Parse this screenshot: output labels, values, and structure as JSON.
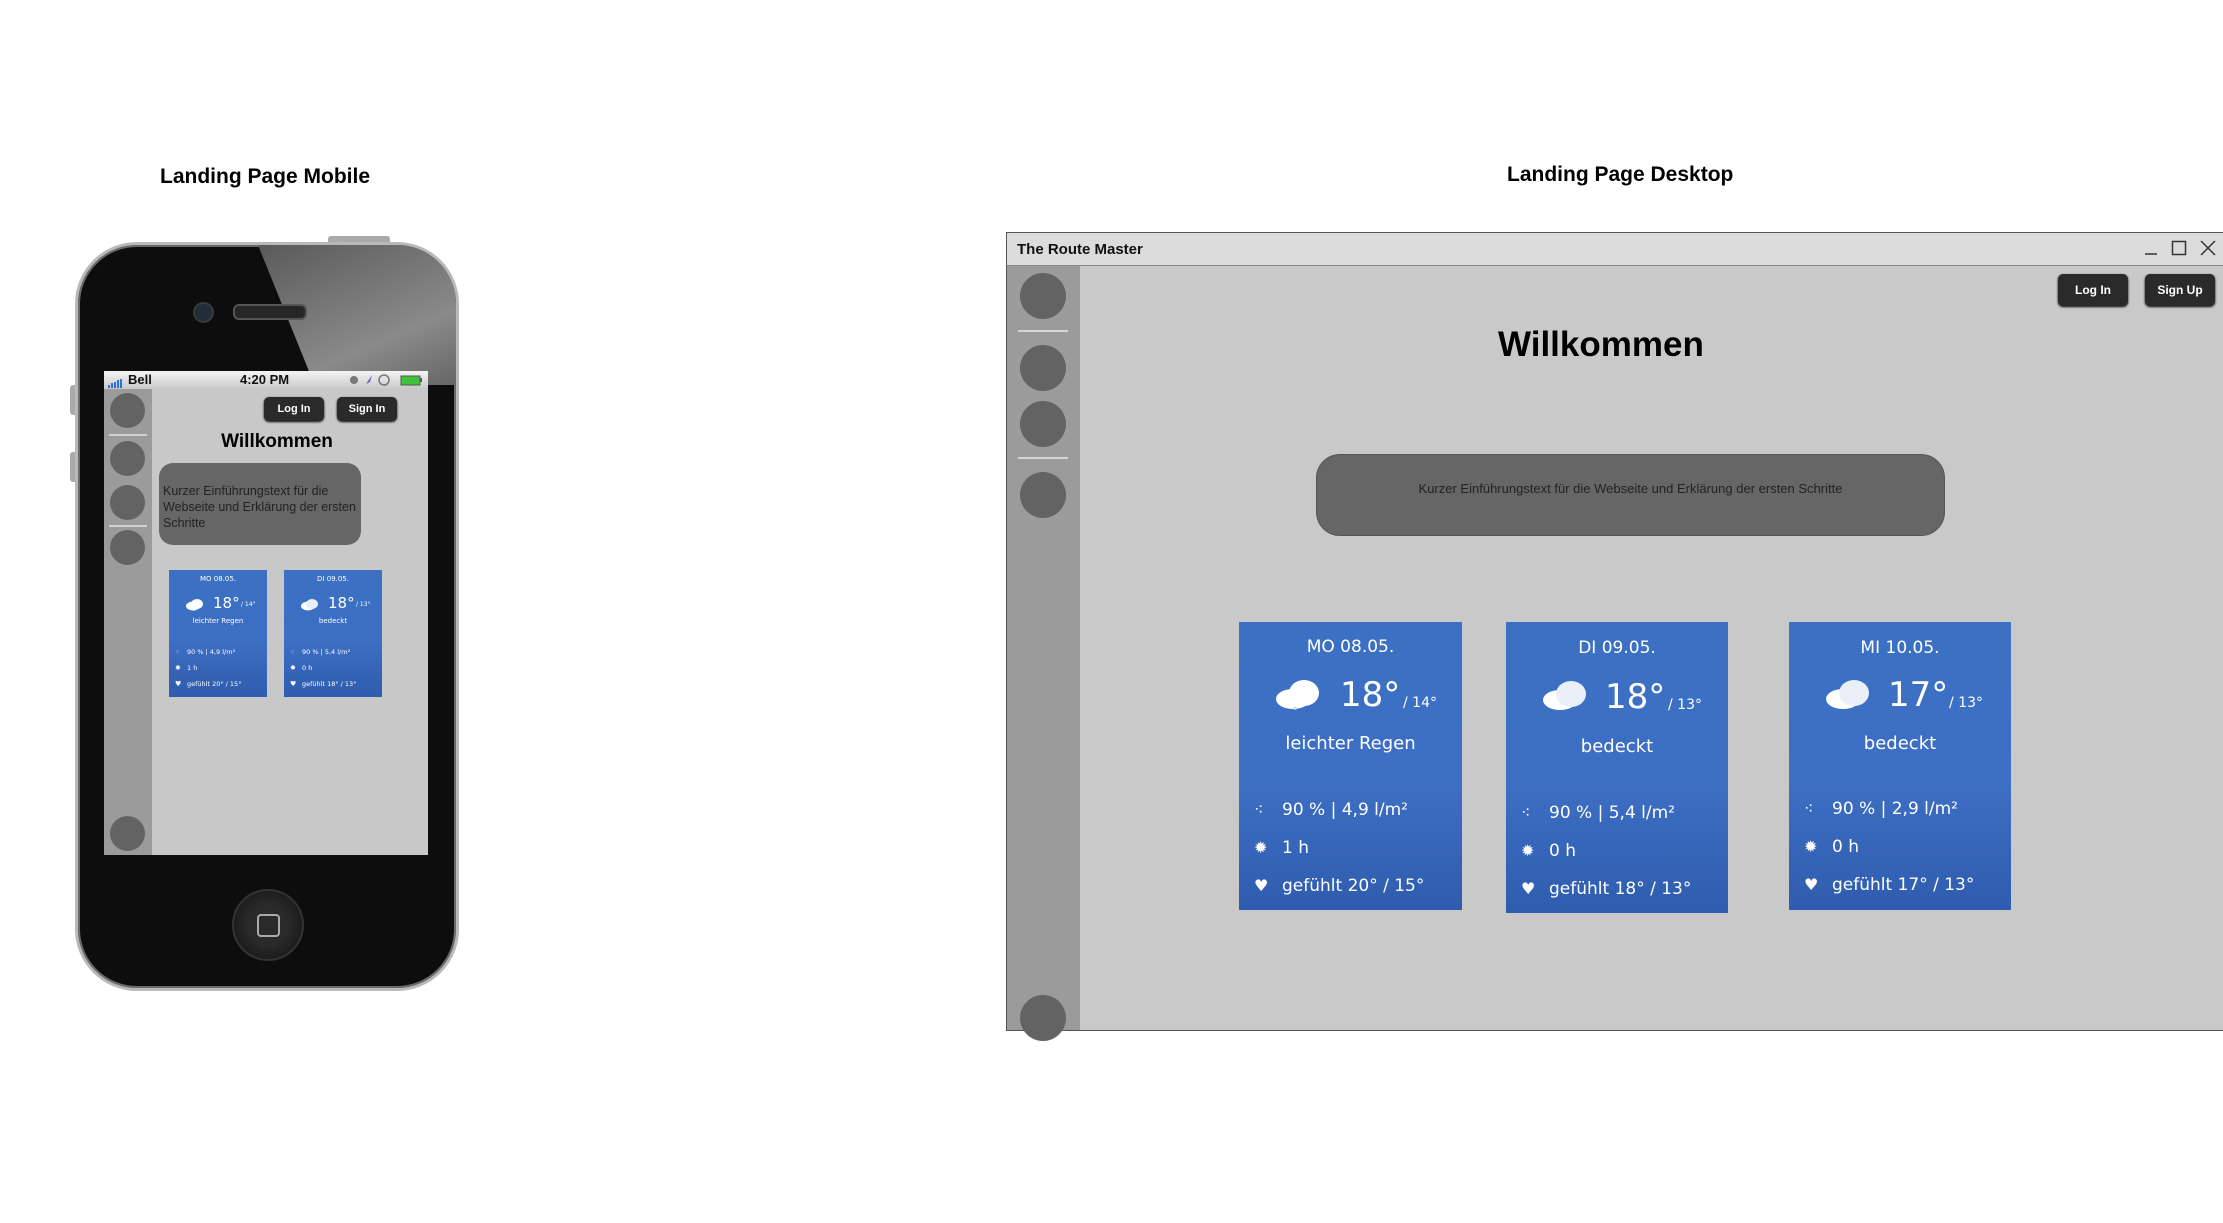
{
  "mobile": {
    "heading": "Landing Page Mobile",
    "status_bar": {
      "carrier": "Bell",
      "time": "4:20 PM"
    },
    "login_label": "Log In",
    "signup_label": "Sign In",
    "welcome": "Willkommen",
    "intro_text": "Kurzer Einführungstext für die Webseite und Erklärung der ersten Schritte",
    "cards": [
      {
        "day": "MO 08.05.",
        "temp": "18°",
        "low": "/ 14°",
        "condition": "leichter Regen",
        "rain": "90 % | 4,9 l/m²",
        "sun": "1 h",
        "feels": "gefühlt 20° / 15°"
      },
      {
        "day": "DI 09.05.",
        "temp": "18°",
        "low": "/ 13°",
        "condition": "bedeckt",
        "rain": "90 % | 5,4 l/m²",
        "sun": "0 h",
        "feels": "gefühlt 18° / 13°"
      }
    ]
  },
  "desktop": {
    "heading": "Landing Page Desktop",
    "window_title": "The Route Master",
    "login_label": "Log In",
    "signup_label": "Sign Up",
    "welcome": "Willkommen",
    "intro_text": "Kurzer Einführungstext für die Webseite und Erklärung der ersten Schritte",
    "cards": [
      {
        "day": "MO 08.05.",
        "temp": "18°",
        "low": "/ 14°",
        "condition": "leichter Regen",
        "rain": "90 % | 4,9 l/m²",
        "sun": "1 h",
        "feels": "gefühlt 20° / 15°"
      },
      {
        "day": "DI 09.05.",
        "temp": "18°",
        "low": "/ 13°",
        "condition": "bedeckt",
        "rain": "90 % | 5,4 l/m²",
        "sun": "0 h",
        "feels": "gefühlt 18° / 13°"
      },
      {
        "day": "MI 10.05.",
        "temp": "17°",
        "low": "/ 13°",
        "condition": "bedeckt",
        "rain": "90 % | 2,9 l/m²",
        "sun": "0 h",
        "feels": "gefühlt 17° / 13°"
      }
    ]
  },
  "colors": {
    "card_blue": "#3b70c3",
    "sidebar": "#9b9b9b",
    "canvas": "#c9c9c9",
    "button": "#2a2a2a"
  }
}
